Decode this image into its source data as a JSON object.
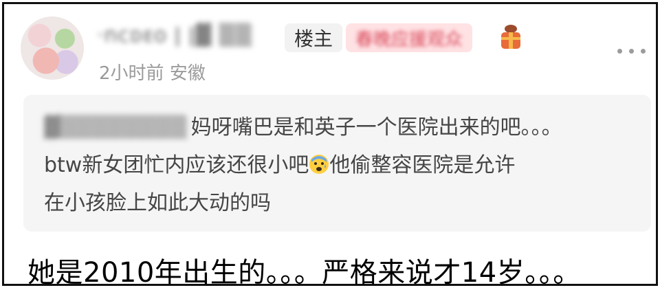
{
  "comment": {
    "username": "·nᴄᴅᴇᴏ ǀ ǀ▓ ▒▒",
    "owner_tag": "楼主",
    "title_tag": "春晚应援观众",
    "time": "2小时前",
    "location": "安徽",
    "badge_icon": "gift-badge-icon",
    "more_icon": "more-dots-icon",
    "quote": {
      "user": "▓▒▒▒▒▒▒▒▒",
      "line1": "妈呀嘴巴是和英子一个医院出来的吧。。。",
      "line2_a": "btw新女团忙内应该还很小吧",
      "emoji": "anxious-face-icon",
      "line2_b": "他偷整容医院是允许",
      "line3": "在小孩脸上如此大动的吗"
    }
  },
  "reply_text": "她是2010年出生的。。。严格来说才14岁。。。"
}
